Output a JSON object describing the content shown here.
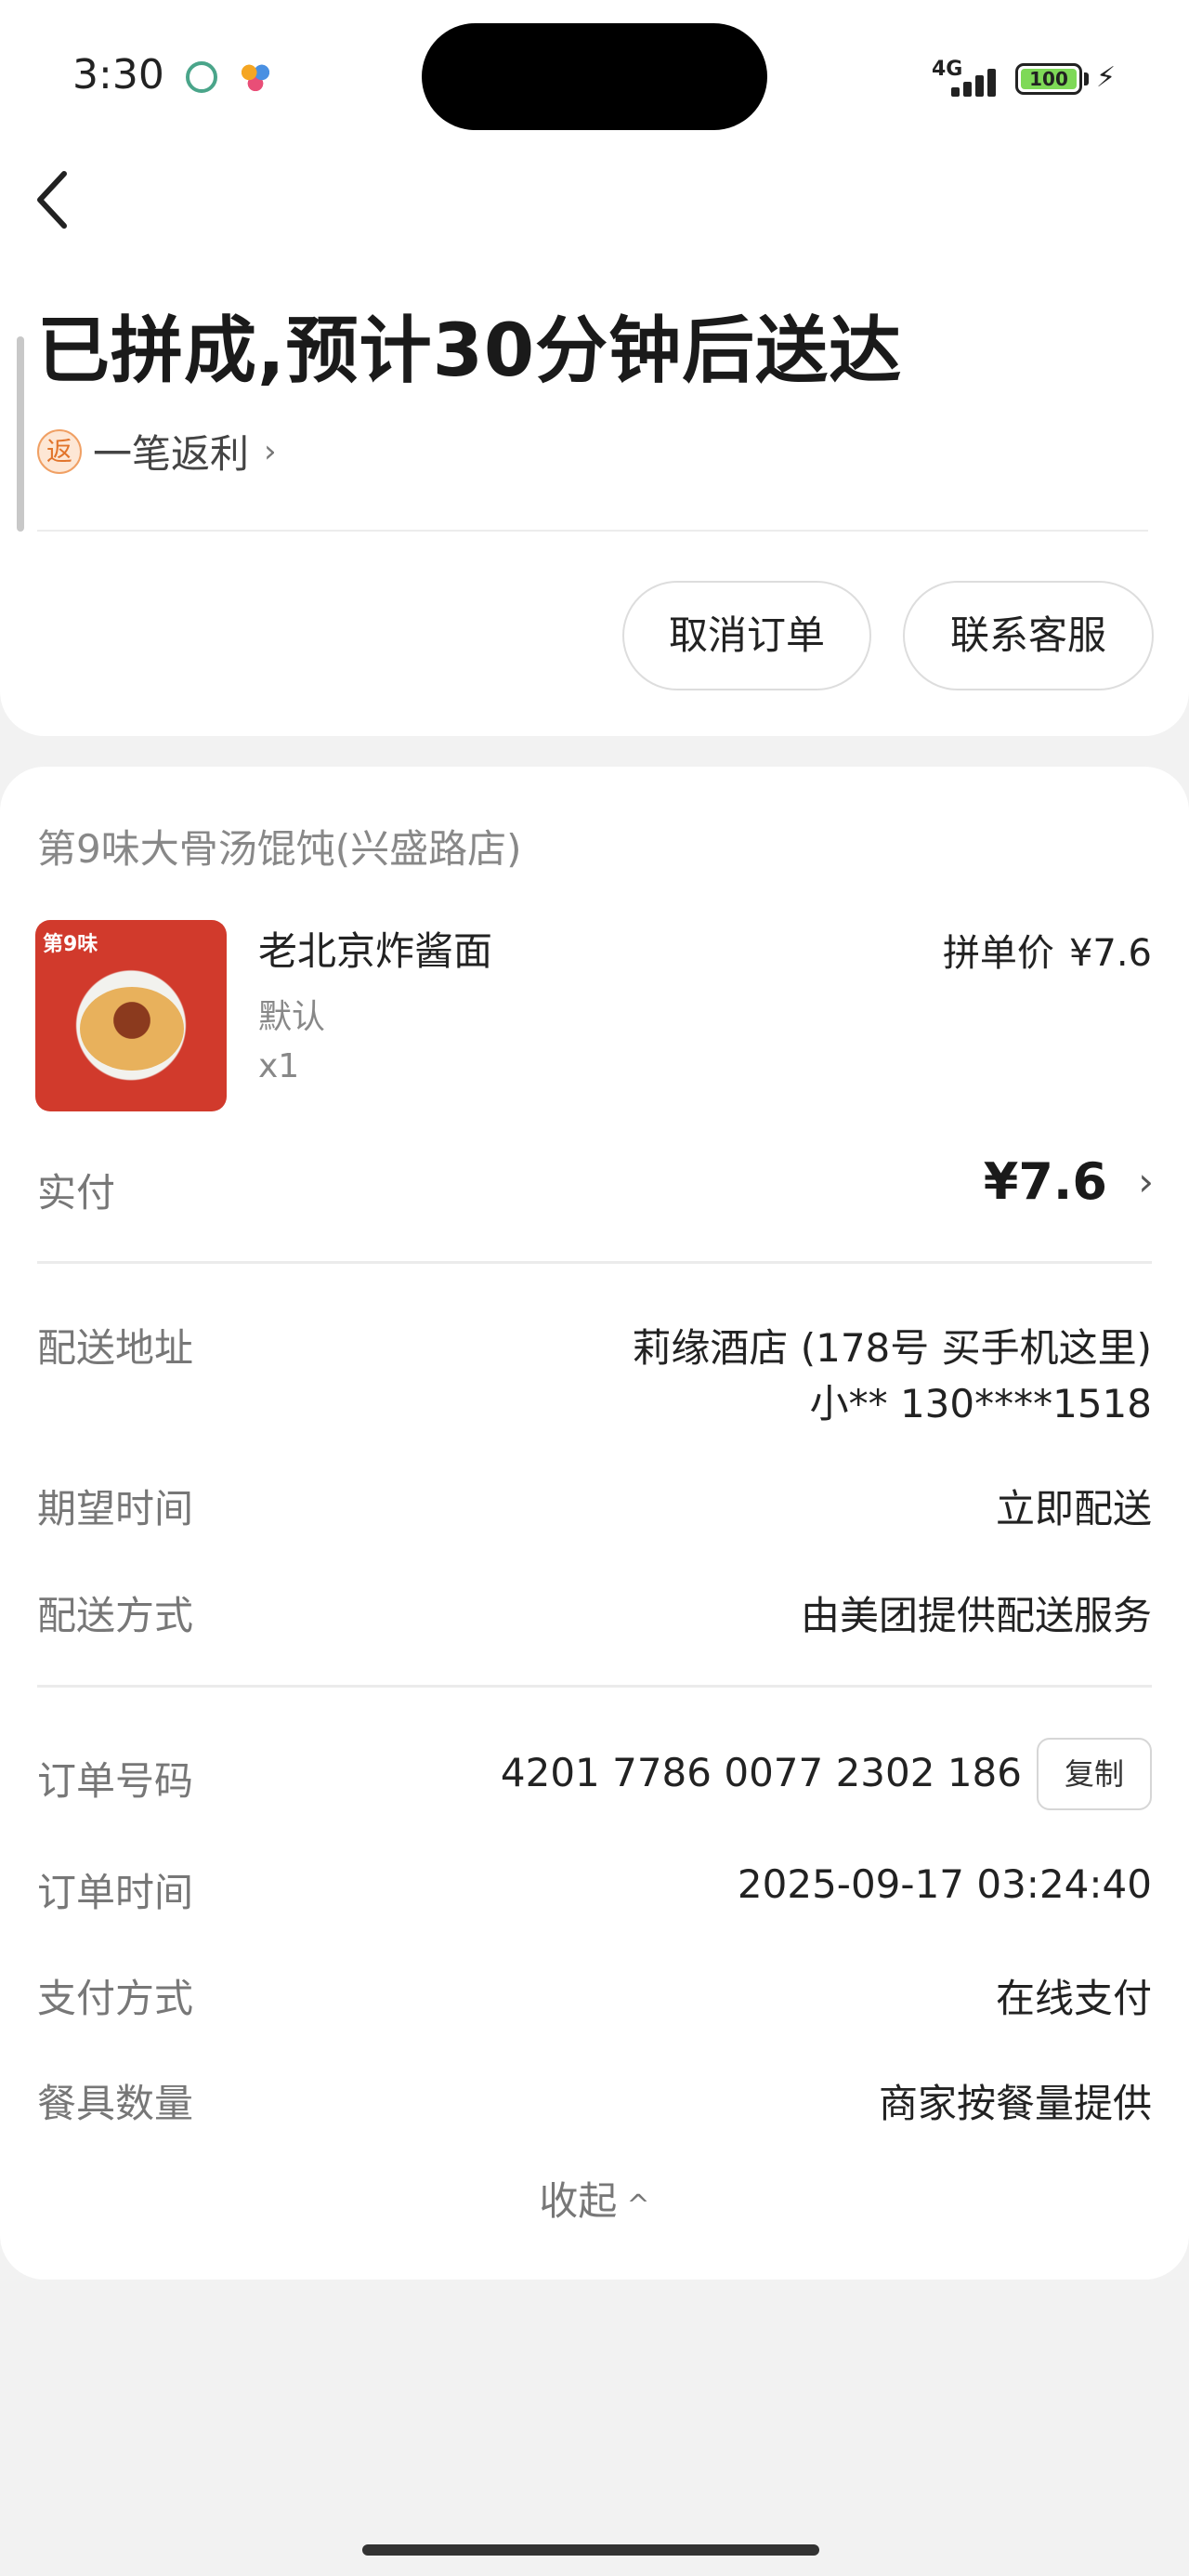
{
  "status_bar": {
    "time": "3:30",
    "network": "4G",
    "battery": "100"
  },
  "header": {
    "status_title": "已拼成,预计30分钟后送达",
    "rebate_badge": "返",
    "rebate_text": "一笔返利",
    "cancel_order": "取消订单",
    "contact_service": "联系客服"
  },
  "order": {
    "shop_name": "第9味大骨汤馄饨(兴盛路店)",
    "item": {
      "name": "老北京炸酱面",
      "spec": "默认",
      "qty": "x1",
      "price_label": "拼单价",
      "price": "¥7.6",
      "thumb_brand": "第9味"
    },
    "paid_label": "实付",
    "paid_amount": "¥7.6",
    "delivery_address_label": "配送地址",
    "delivery_address_line1": "莉缘酒店 (178号 买手机这里)",
    "delivery_address_line2": "小** 130****1518",
    "expected_time_label": "期望时间",
    "expected_time": "立即配送",
    "delivery_method_label": "配送方式",
    "delivery_method": "由美团提供配送服务",
    "order_number_label": "订单号码",
    "order_number": "4201 7786 0077 2302 186",
    "copy_label": "复制",
    "order_time_label": "订单时间",
    "order_time": "2025-09-17 03:24:40",
    "payment_method_label": "支付方式",
    "payment_method": "在线支付",
    "tableware_label": "餐具数量",
    "tableware": "商家按餐量提供",
    "collapse_label": "收起"
  },
  "icons": {
    "back": "back-arrow-icon",
    "chevron": "chevron-right-icon",
    "collapse": "chevron-up-icon"
  }
}
